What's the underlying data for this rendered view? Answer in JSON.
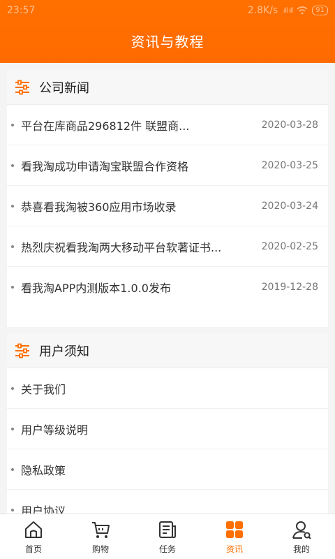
{
  "status_bar": {
    "time": "23:57",
    "speed": "2.8K/s",
    "signal": ".ıll ıll",
    "battery": "91"
  },
  "header": {
    "title": "资讯与教程"
  },
  "sections": {
    "news": {
      "title": "公司新闻",
      "items": [
        {
          "title": "平台在库商品296812件 联盟商...",
          "date": "2020-03-28"
        },
        {
          "title": "看我淘成功申请淘宝联盟合作资格",
          "date": "2020-03-25"
        },
        {
          "title": "恭喜看我淘被360应用市场收录",
          "date": "2020-03-24"
        },
        {
          "title": "热烈庆祝看我淘两大移动平台软著证书...",
          "date": "2020-02-25"
        },
        {
          "title": "看我淘APP内测版本1.0.0发布",
          "date": "2019-12-28"
        }
      ]
    },
    "notice": {
      "title": "用户须知",
      "items": [
        {
          "title": "关于我们"
        },
        {
          "title": "用户等级说明"
        },
        {
          "title": "隐私政策"
        },
        {
          "title": "用户协议"
        }
      ]
    }
  },
  "tabs": [
    {
      "label": "首页",
      "icon": "home-icon"
    },
    {
      "label": "购物",
      "icon": "cart-icon"
    },
    {
      "label": "任务",
      "icon": "task-icon"
    },
    {
      "label": "资讯",
      "icon": "grid-icon"
    },
    {
      "label": "我的",
      "icon": "user-icon"
    }
  ],
  "active_tab": "资讯",
  "colors": {
    "accent": "#ff6f00",
    "background": "#f4f4f4",
    "card_header": "#f7f7f7"
  }
}
